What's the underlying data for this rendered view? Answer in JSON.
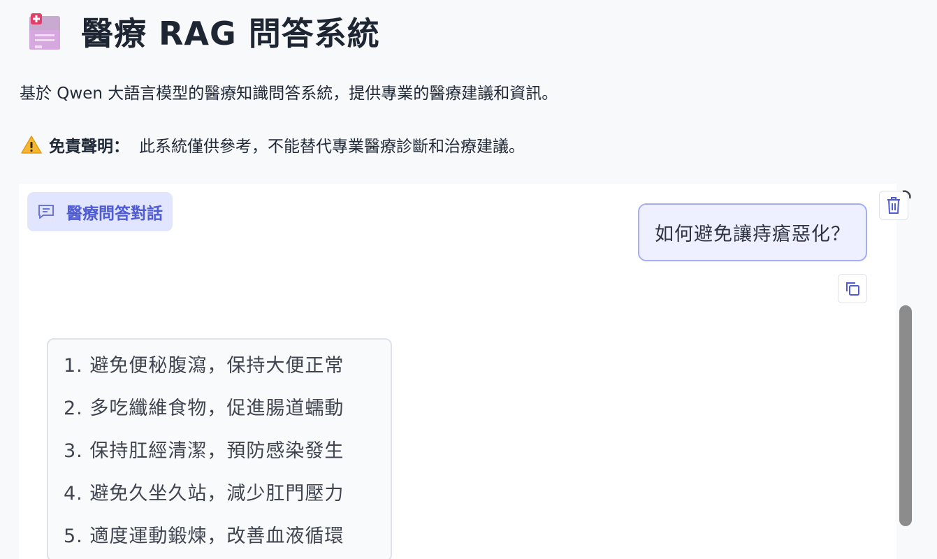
{
  "header": {
    "logo_icon": "medical-clipboard-icon",
    "title": "醫療 RAG 問答系統"
  },
  "subtitle": "基於 Qwen 大語言模型的醫療知識問答系統，提供專業的醫療建議和資訊。",
  "disclaimer": {
    "icon": "warning-icon",
    "label": "免責聲明：",
    "text": "此系統僅供參考，不能替代專業醫療診斷和治療建議。"
  },
  "chat": {
    "tag_icon": "chat-icon",
    "tag_label": "醫療問答對話",
    "user_message": "如何避免讓痔瘡惡化？",
    "copy_icon": "copy-icon",
    "trash_icon": "trash-icon",
    "bot_lines": [
      "1. 避免便秘腹瀉，保持大便正常",
      "2. 多吃纖維食物，促進腸道蠕動",
      "3. 保持肛經清潔，預防感染發生",
      "4. 避免久坐久站，減少肛門壓力",
      "5. 適度運動鍛煉，改善血液循環"
    ]
  },
  "colors": {
    "accent": "#4f5bd5",
    "tag_bg": "#e1e5fd",
    "user_bubble_bg": "#eef0ff",
    "user_bubble_border": "#a5adf5",
    "scrollbar": "#8c8c8c"
  }
}
